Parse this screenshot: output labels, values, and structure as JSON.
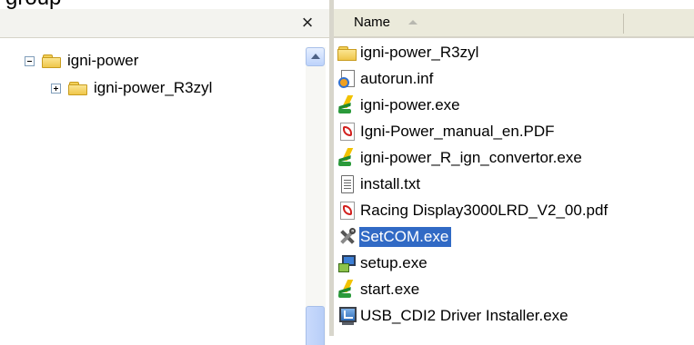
{
  "top_caption": "group",
  "tree": {
    "close_glyph": "×",
    "nodes": [
      {
        "label": "igni-power",
        "expander": "minus"
      },
      {
        "label": "igni-power_R3zyl",
        "expander": "plus"
      }
    ]
  },
  "files": {
    "column_name": "Name",
    "items": [
      {
        "name": "igni-power_R3zyl",
        "icon": "folder-icon"
      },
      {
        "name": "autorun.inf",
        "icon": "inf-file-icon"
      },
      {
        "name": "igni-power.exe",
        "icon": "exe-bolt-icon"
      },
      {
        "name": "Igni-Power_manual_en.PDF",
        "icon": "pdf-icon"
      },
      {
        "name": "igni-power_R_ign_convertor.exe",
        "icon": "exe-bolt-icon"
      },
      {
        "name": "install.txt",
        "icon": "text-file-icon"
      },
      {
        "name": "Racing Display3000LRD_V2_00.pdf",
        "icon": "pdf-icon"
      },
      {
        "name": "SetCOM.exe",
        "icon": "tools-icon",
        "selected": true
      },
      {
        "name": "setup.exe",
        "icon": "setup-icon"
      },
      {
        "name": "start.exe",
        "icon": "exe-bolt-icon"
      },
      {
        "name": "USB_CDI2 Driver Installer.exe",
        "icon": "usb-installer-icon"
      }
    ]
  },
  "colors": {
    "selection": "#316ac5",
    "header_bg": "#ebeadb",
    "scrollbar_accent": "#bdd3fb"
  }
}
